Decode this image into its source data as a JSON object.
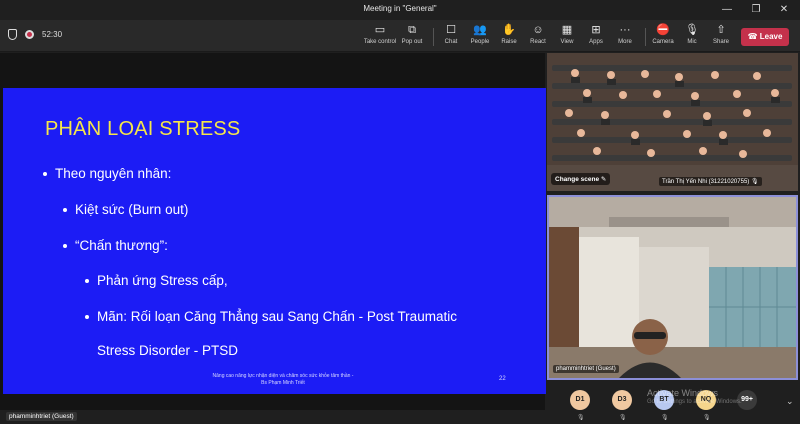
{
  "window": {
    "title": "Meeting in \"General\""
  },
  "toolbar": {
    "timer": "52:30",
    "buttons": [
      {
        "label": "Take control",
        "icon": "take-control-icon"
      },
      {
        "label": "Pop out",
        "icon": "pop-out-icon"
      },
      {
        "label": "Chat",
        "icon": "chat-icon"
      },
      {
        "label": "People",
        "icon": "people-icon"
      },
      {
        "label": "Raise",
        "icon": "raise-hand-icon"
      },
      {
        "label": "React",
        "icon": "react-icon"
      },
      {
        "label": "View",
        "icon": "view-icon"
      },
      {
        "label": "Apps",
        "icon": "apps-icon"
      },
      {
        "label": "More",
        "icon": "more-icon"
      },
      {
        "label": "Camera",
        "icon": "camera-off-icon"
      },
      {
        "label": "Mic",
        "icon": "mic-off-icon"
      },
      {
        "label": "Share",
        "icon": "share-icon"
      }
    ],
    "leave_label": "Leave",
    "leave_color": "#c4314b"
  },
  "slide": {
    "title": "PHÂN LOẠI STRESS",
    "bullets": [
      "Theo nguyên nhân:",
      "Kiệt sức (Burn out)",
      "“Chấn thương”:",
      "Phản ứng Stress cấp,",
      "Mãn: Rối loạn Căng Thẳng sau Sang Chấn - Post Traumatic",
      "Stress Disorder - PTSD"
    ],
    "footer_line1": "Nâng cao năng lực nhận diện và chăm sóc sức khỏe tâm thần -",
    "footer_line2": "Bs Phạm Minh Triết",
    "page_number": "22",
    "background": "#1c1cf5",
    "title_color": "#f5e64a"
  },
  "participants": {
    "panel1_name": "Trần Thị Yến Nhi (31221020755)",
    "change_scene": "Change scene",
    "panel2_name": "phamminhtriet (Guest)",
    "presenter_label": "phamminhtriet (Guest)",
    "avatars": [
      {
        "initials": "D1",
        "color": "#f0c8a0"
      },
      {
        "initials": "D3",
        "color": "#f0c8a0"
      },
      {
        "initials": "BT",
        "color": "#b8c8f0"
      },
      {
        "initials": "NQ",
        "color": "#f5d58c"
      }
    ],
    "overflow_count": "99+"
  },
  "watermark": {
    "line1": "Activate Windows",
    "line2": "Go to Settings to activate Windows."
  }
}
